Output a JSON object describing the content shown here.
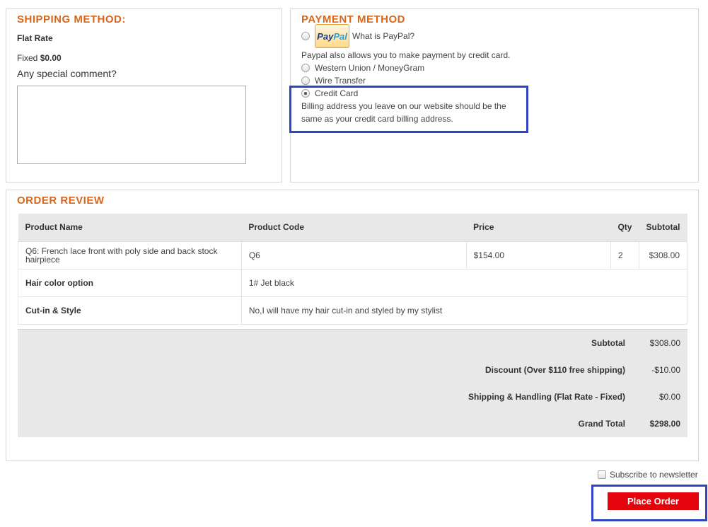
{
  "shipping": {
    "title": "SHIPPING METHOD:",
    "method_name": "Flat Rate",
    "fixed_label": "Fixed",
    "fixed_price": "$0.00",
    "comment_label": "Any special comment?",
    "comment_value": ""
  },
  "payment": {
    "title": "PAYMENT METHOD",
    "paypal_logo_part1": "Pay",
    "paypal_logo_part2": "Pal",
    "paypal_link": "What is PayPal?",
    "paypal_note": "Paypal also allows you to make payment by credit card.",
    "options": [
      {
        "label": "Western Union / MoneyGram",
        "selected": false
      },
      {
        "label": "Wire Transfer",
        "selected": false
      },
      {
        "label": "Credit Card",
        "selected": true
      }
    ],
    "credit_note_line1": "Billing address you leave on our website should be the",
    "credit_note_line2": "same as your credit card billing address."
  },
  "review": {
    "title": "ORDER REVIEW",
    "headers": [
      "Product Name",
      "Product Code",
      "Price",
      "Qty",
      "Subtotal"
    ],
    "item": {
      "name": "Q6: French lace front with poly side and back stock hairpiece",
      "code": "Q6",
      "price": "$154.00",
      "qty": "2",
      "subtotal": "$308.00"
    },
    "options": [
      {
        "label": "Hair color option",
        "value": "1# Jet black"
      },
      {
        "label": "Cut-in & Style",
        "value": "No,I will have my hair cut-in and styled by my stylist"
      }
    ],
    "totals": [
      {
        "label": "Subtotal",
        "value": "$308.00"
      },
      {
        "label": "Discount (Over $110 free shipping)",
        "value": "-$10.00"
      },
      {
        "label": "Shipping & Handling (Flat Rate - Fixed)",
        "value": "$0.00"
      },
      {
        "label": "Grand Total",
        "value": "$298.00"
      }
    ]
  },
  "footer": {
    "newsletter_label": "Subscribe to newsletter",
    "place_order": "Place Order"
  },
  "colors": {
    "section_title": "#d9661b",
    "place_order_bg": "#e3050b",
    "highlight": "#2f45c6"
  }
}
